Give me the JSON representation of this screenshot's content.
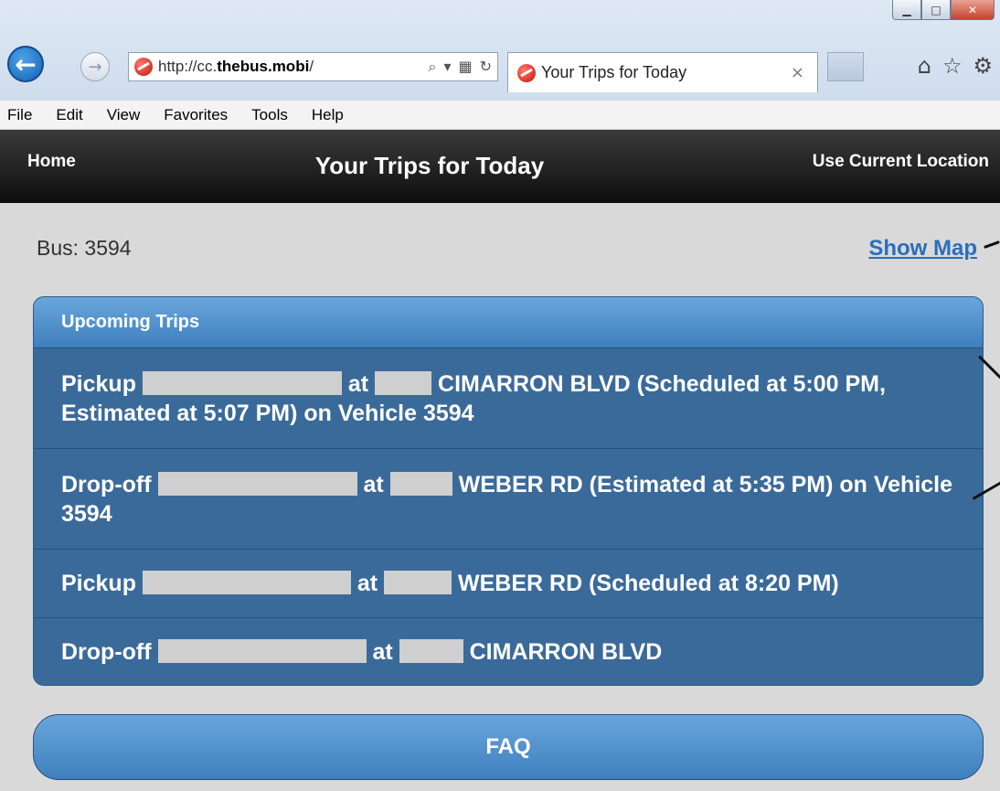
{
  "browser": {
    "url_prefix": "http://cc.",
    "url_domain": "thebus.mobi",
    "url_suffix": "/",
    "tab_title": "Your Trips for Today",
    "menu": [
      "File",
      "Edit",
      "View",
      "Favorites",
      "Tools",
      "Help"
    ]
  },
  "header": {
    "home": "Home",
    "title": "Your Trips for Today",
    "location": "Use Current Location"
  },
  "bus": {
    "label": "Bus: 3594",
    "show_map": "Show Map"
  },
  "trips": {
    "heading": "Upcoming Trips",
    "items": [
      {
        "a": "Pickup",
        "b": "at",
        "c": "CIMARRON BLVD (Scheduled at 5:00 PM, Estimated at 5:07 PM) on Vehicle 3594"
      },
      {
        "a": "Drop-off",
        "b": "at",
        "c": "WEBER RD (Estimated at 5:35 PM) on Vehicle 3594"
      },
      {
        "a": "Pickup",
        "b": "at",
        "c": "WEBER RD (Scheduled at 8:20 PM)"
      },
      {
        "a": "Drop-off",
        "b": "at",
        "c": "CIMARRON BLVD"
      }
    ]
  },
  "faq": "FAQ",
  "colors": {
    "header": "#111111",
    "accent": "#3e7fbd",
    "link": "#2a6ebb"
  }
}
